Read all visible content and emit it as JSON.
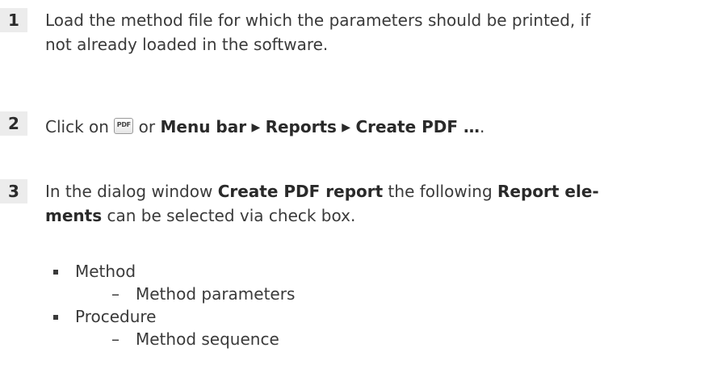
{
  "steps": [
    {
      "number": "1",
      "line1": "Load the method file for which the parameters should be printed, if",
      "line2": "not already loaded in the software."
    },
    {
      "number": "2",
      "prefix": "Click on ",
      "icon_label": "PDF",
      "or": " or ",
      "menu_bar": "Menu bar",
      "arrow": "▶",
      "reports": "Reports",
      "create_pdf": "Create PDF …",
      "end": "."
    },
    {
      "number": "3",
      "text_a": "In the dialog window ",
      "dialog_name": "Create PDF report",
      "text_b": " the following ",
      "report_ele": "Report ele-",
      "ments": "ments",
      "text_c": " can be selected via check box."
    }
  ],
  "report_elements": [
    {
      "label": "Method",
      "sub": "Method parameters"
    },
    {
      "label": "Procedure",
      "sub": "Method sequence"
    }
  ],
  "dash": "–"
}
